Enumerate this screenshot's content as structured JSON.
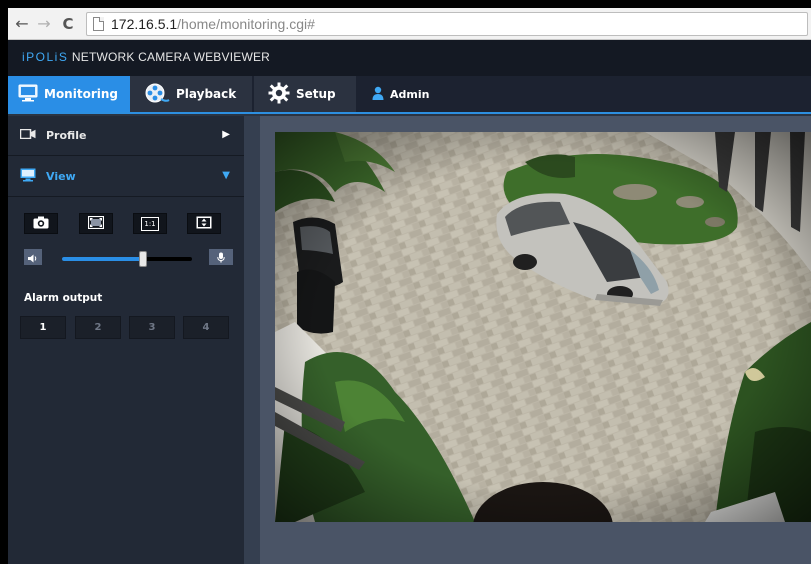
{
  "browser": {
    "url_host": "172.16.5.1",
    "url_path": "/home/monitoring.cgi#"
  },
  "app": {
    "brand_ipolis": "iPOLiS",
    "brand_rest": " NETWORK CAMERA WEBVIEWER"
  },
  "tabs": {
    "monitoring": "Monitoring",
    "playback": "Playback",
    "setup": "Setup",
    "admin": "Admin"
  },
  "sidebar": {
    "profile_label": "Profile",
    "view_label": "View",
    "original_size_label": "1:1",
    "alarm_output_label": "Alarm output",
    "alarm_buttons": [
      "1",
      "2",
      "3",
      "4"
    ],
    "active_alarm": "1"
  },
  "volume": {
    "level_fraction": 0.62
  },
  "colors": {
    "accent": "#2a8ee6",
    "brand": "#3fa9f5",
    "sidebar_bg": "#222936"
  },
  "icons": {
    "back": "back-arrow-icon",
    "forward": "forward-arrow-icon",
    "reload": "reload-icon",
    "page": "page-icon",
    "monitoring": "monitor-icon",
    "playback": "film-reel-icon",
    "setup": "gear-icon",
    "admin": "user-icon",
    "profile": "camera-icon",
    "view": "monitor-icon",
    "snapshot": "camera-icon",
    "fit": "fit-screen-icon",
    "original": "original-size-icon",
    "fullscreen": "fullscreen-icon",
    "mute": "speaker-icon",
    "mic": "microphone-icon"
  }
}
